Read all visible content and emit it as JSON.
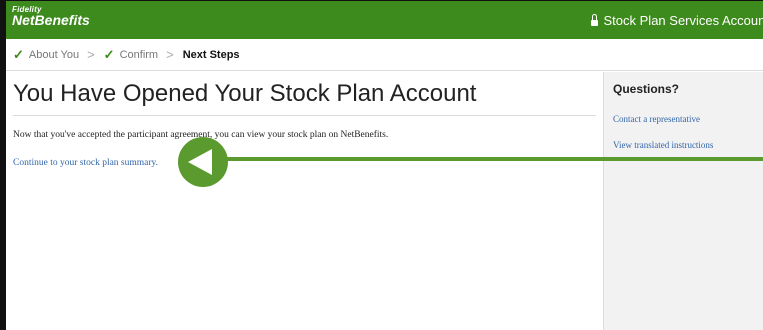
{
  "header": {
    "logo_line1": "Fidelity",
    "logo_line2": "NetBenefits",
    "right_title": "Stock Plan Services Account",
    "brand_color": "#3d8a1d"
  },
  "steps": [
    {
      "label": "About You",
      "status": "done"
    },
    {
      "label": "Confirm",
      "status": "done"
    },
    {
      "label": "Next Steps",
      "status": "current"
    }
  ],
  "main": {
    "title": "You Have Opened Your Stock Plan Account",
    "body": "Now that you've accepted the participant agreement, you can view your stock plan on NetBenefits.",
    "link_summary": "Continue to your stock plan summary."
  },
  "sidebar": {
    "title": "Questions?",
    "links": [
      "Contact a representative",
      "View translated instructions"
    ]
  },
  "overlay": {
    "icon": "left-arrow-pointer-icon",
    "color": "#5a9a2e"
  }
}
